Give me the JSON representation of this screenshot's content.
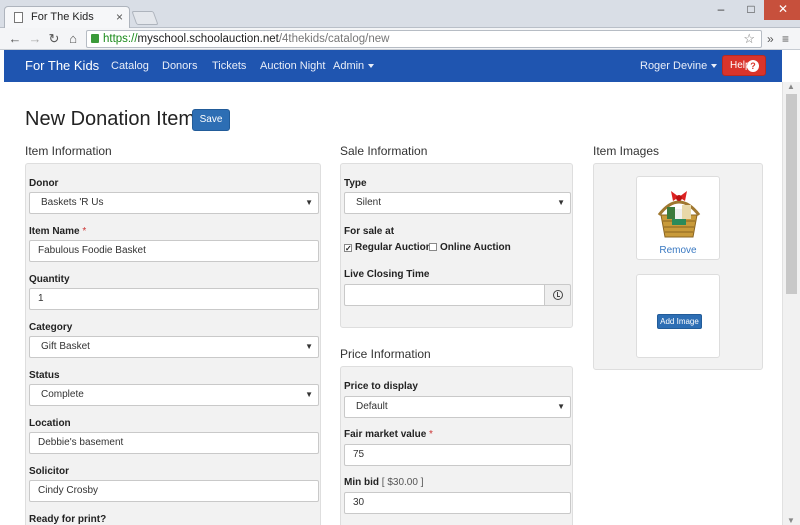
{
  "browser": {
    "tab_title": "For The Kids",
    "url_https": "https://",
    "url_host": "myschool.schoolauction.net",
    "url_path": "/4thekids/catalog/new"
  },
  "navbar": {
    "brand": "For The Kids",
    "links": [
      "Catalog",
      "Donors",
      "Tickets",
      "Auction Night",
      "Admin"
    ],
    "user": "Roger Devine",
    "help": "Help",
    "help_icon": "?"
  },
  "page": {
    "title": "New Donation Item",
    "save": "Save"
  },
  "item_info": {
    "heading": "Item Information",
    "donor_label": "Donor",
    "donor_value": "Baskets 'R Us",
    "item_name_label": "Item Name",
    "item_name_value": "Fabulous Foodie Basket",
    "quantity_label": "Quantity",
    "quantity_value": "1",
    "category_label": "Category",
    "category_value": "Gift Basket",
    "status_label": "Status",
    "status_value": "Complete",
    "location_label": "Location",
    "location_value": "Debbie's basement",
    "solicitor_label": "Solicitor",
    "solicitor_value": "Cindy Crosby",
    "ready_label": "Ready for print?"
  },
  "sale_info": {
    "heading": "Sale Information",
    "type_label": "Type",
    "type_value": "Silent",
    "for_sale_label": "For sale at",
    "regular_auction": "Regular Auction",
    "online_auction": "Online Auction",
    "closing_time_label": "Live Closing Time"
  },
  "price_info": {
    "heading": "Price Information",
    "display_label": "Price to display",
    "display_value": "Default",
    "fmv_label": "Fair market value",
    "fmv_value": "75",
    "min_bid_label": "Min bid",
    "min_bid_note": "[ $30.00 ]",
    "min_bid_value": "30"
  },
  "images": {
    "heading": "Item Images",
    "remove": "Remove",
    "add_image": "Add Image"
  },
  "required_mark": "*"
}
